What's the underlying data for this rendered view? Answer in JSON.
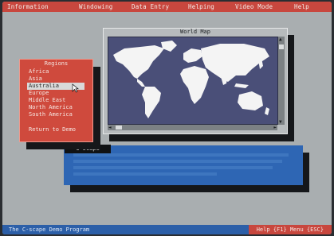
{
  "menubar": {
    "items": [
      "Information",
      "Windowing",
      "Data Entry",
      "Helping",
      "Video Mode",
      "Help"
    ]
  },
  "map_window": {
    "title": "World Map"
  },
  "regions_menu": {
    "title": "Regions",
    "items": [
      "Africa",
      "Asia",
      "Australia",
      "Europe",
      "Middle East",
      "North America",
      "South America"
    ],
    "selected": "Australia",
    "return_label": "Return to Demo"
  },
  "info_panel": {
    "tab_label": "C-scape"
  },
  "statusbar": {
    "left_text": "The C-scape Demo Program",
    "right_text": "Help {F1}   Menu {ESC}"
  },
  "colors": {
    "desktop": "#a9aeb0",
    "menubar": "#c8473e",
    "menu_panel": "#cf4a3d",
    "map_water": "#4a4f78",
    "info_panel": "#2e66b4",
    "statusbar": "#2c5fa8"
  }
}
